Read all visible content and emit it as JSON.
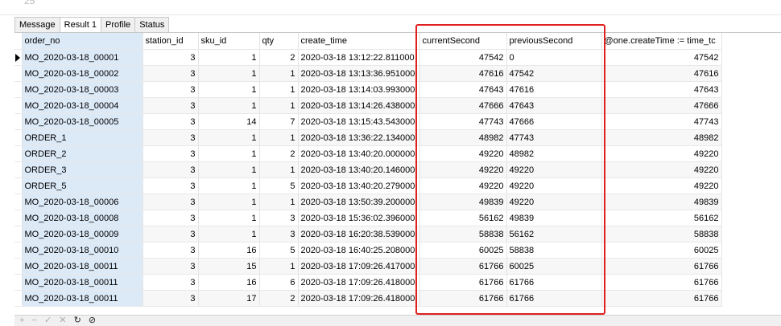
{
  "editor": {
    "line_number": "25"
  },
  "tabs": [
    "Message",
    "Result 1",
    "Profile",
    "Status"
  ],
  "grid": {
    "columns": [
      "order_no",
      "station_id",
      "sku_id",
      "qty",
      "create_time",
      "currentSecond",
      "previousSecond",
      "@one.createTime := time_tc"
    ],
    "rows": [
      [
        "MO_2020-03-18_00001",
        "3",
        "1",
        "2",
        "2020-03-18 13:12:22.811000",
        "47542",
        "0",
        "47542"
      ],
      [
        "MO_2020-03-18_00002",
        "3",
        "1",
        "1",
        "2020-03-18 13:13:36.951000",
        "47616",
        "47542",
        "47616"
      ],
      [
        "MO_2020-03-18_00003",
        "3",
        "1",
        "1",
        "2020-03-18 13:14:03.993000",
        "47643",
        "47616",
        "47643"
      ],
      [
        "MO_2020-03-18_00004",
        "3",
        "1",
        "1",
        "2020-03-18 13:14:26.438000",
        "47666",
        "47643",
        "47666"
      ],
      [
        "MO_2020-03-18_00005",
        "3",
        "14",
        "7",
        "2020-03-18 13:15:43.543000",
        "47743",
        "47666",
        "47743"
      ],
      [
        "ORDER_1",
        "3",
        "1",
        "1",
        "2020-03-18 13:36:22.134000",
        "48982",
        "47743",
        "48982"
      ],
      [
        "ORDER_2",
        "3",
        "1",
        "2",
        "2020-03-18 13:40:20.000000",
        "49220",
        "48982",
        "49220"
      ],
      [
        "ORDER_3",
        "3",
        "1",
        "1",
        "2020-03-18 13:40:20.146000",
        "49220",
        "49220",
        "49220"
      ],
      [
        "ORDER_5",
        "3",
        "1",
        "5",
        "2020-03-18 13:40:20.279000",
        "49220",
        "49220",
        "49220"
      ],
      [
        "MO_2020-03-18_00006",
        "3",
        "1",
        "1",
        "2020-03-18 13:50:39.200000",
        "49839",
        "49220",
        "49839"
      ],
      [
        "MO_2020-03-18_00008",
        "3",
        "1",
        "3",
        "2020-03-18 15:36:02.396000",
        "56162",
        "49839",
        "56162"
      ],
      [
        "MO_2020-03-18_00009",
        "3",
        "1",
        "3",
        "2020-03-18 16:20:38.539000",
        "58838",
        "56162",
        "58838"
      ],
      [
        "MO_2020-03-18_00010",
        "3",
        "16",
        "5",
        "2020-03-18 16:40:25.208000",
        "60025",
        "58838",
        "60025"
      ],
      [
        "MO_2020-03-18_00011",
        "3",
        "15",
        "1",
        "2020-03-18 17:09:26.417000",
        "61766",
        "60025",
        "61766"
      ],
      [
        "MO_2020-03-18_00011",
        "3",
        "16",
        "6",
        "2020-03-18 17:09:26.418000",
        "61766",
        "61766",
        "61766"
      ],
      [
        "MO_2020-03-18_00011",
        "3",
        "17",
        "2",
        "2020-03-18 17:09:26.418000",
        "61766",
        "61766",
        "61766"
      ]
    ],
    "current_row_index": 0
  },
  "bottom_toolbar": [
    "+",
    "−",
    "✓",
    "✕",
    "↻",
    "⊘"
  ],
  "icons": {
    "row_marker": "current-row-marker-icon",
    "add": "add-icon",
    "delete": "delete-icon",
    "apply": "apply-icon",
    "discard": "discard-icon",
    "refresh": "refresh-icon",
    "stop": "stop-icon"
  },
  "colors": {
    "highlight_border": "#e02020",
    "selected_cell": "#dce9f7"
  }
}
